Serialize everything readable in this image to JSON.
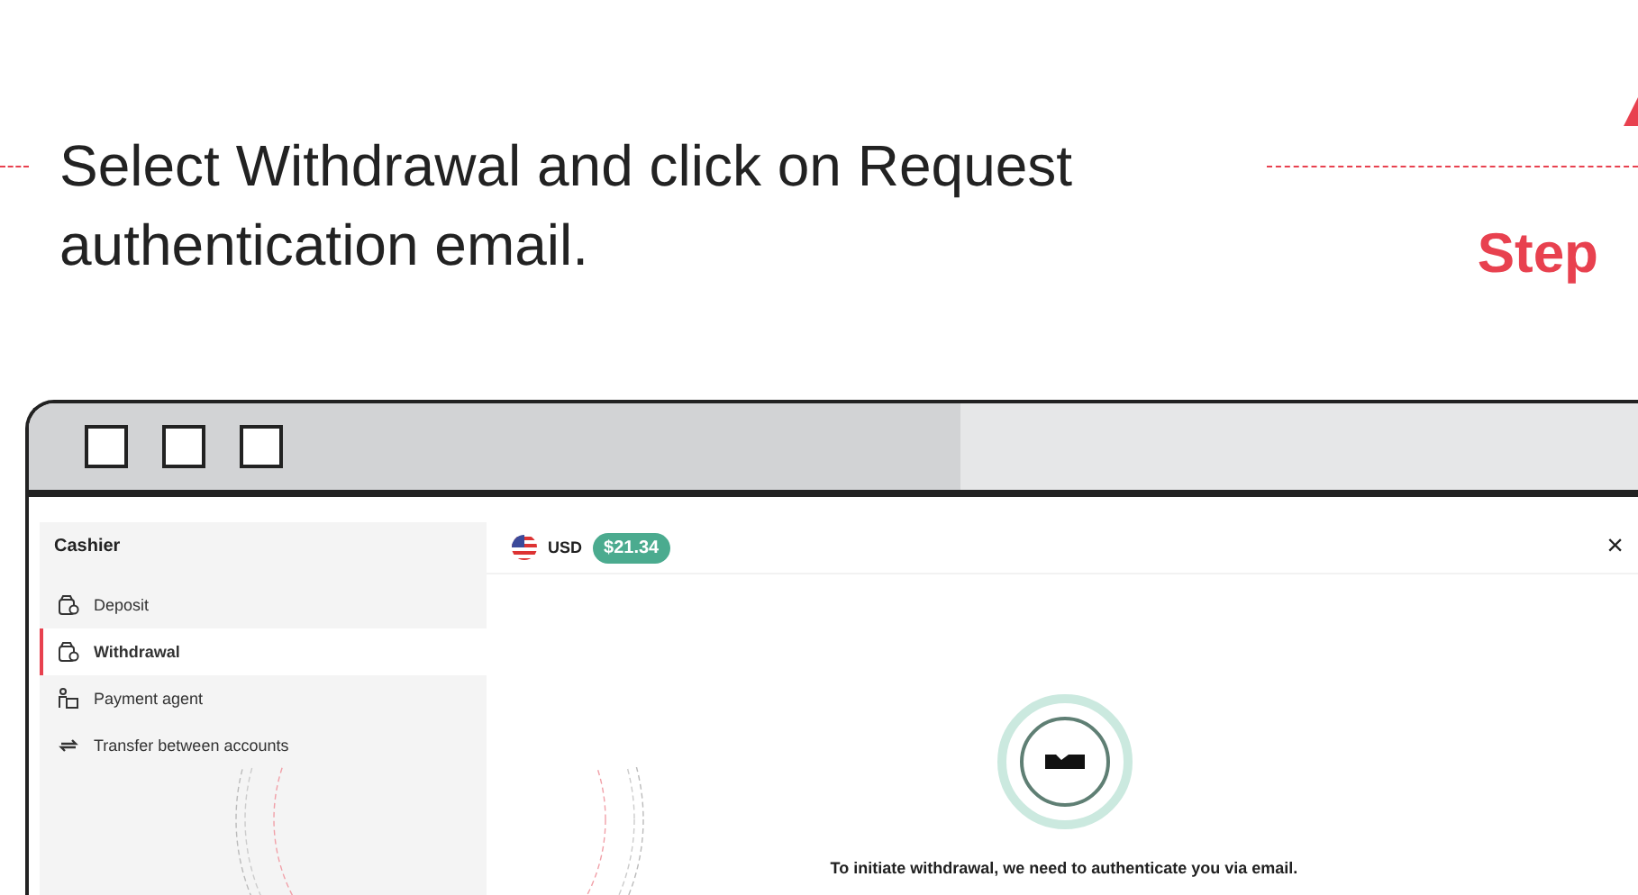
{
  "instruction": {
    "text": "Select Withdrawal and click on Request authentication email.",
    "step_label": "Step"
  },
  "cashier": {
    "title": "Cashier",
    "items": [
      {
        "label": "Deposit",
        "kind": "wallet",
        "selected": false
      },
      {
        "label": "Withdrawal",
        "kind": "wallet",
        "selected": true
      },
      {
        "label": "Payment agent",
        "kind": "agent",
        "selected": false
      },
      {
        "label": "Transfer between accounts",
        "kind": "transfer",
        "selected": false
      }
    ]
  },
  "header": {
    "currency": "USD",
    "balance": "$21.34",
    "close": "×"
  },
  "message": "To initiate withdrawal, we need to authenticate you via email."
}
